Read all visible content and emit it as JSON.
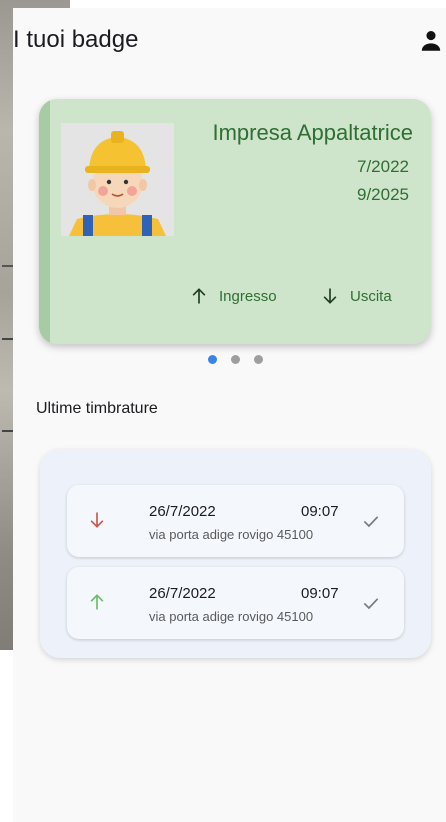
{
  "header": {
    "title": "I tuoi badge",
    "account_icon": "person-icon"
  },
  "badge": {
    "company": "Impresa Appaltatrice",
    "date_start": "7/2022",
    "date_end": "9/2025",
    "entry_label": "Ingresso",
    "exit_label": "Uscita",
    "color": "#cfe5cb",
    "accent": "#2e6f33"
  },
  "pager": {
    "count": 3,
    "active_index": 0
  },
  "recent": {
    "title": "Ultime timbrature",
    "items": [
      {
        "direction": "out",
        "date": "26/7/2022",
        "time": "09:07",
        "address": "via porta adige rovigo 45100",
        "status_icon": "check-icon",
        "color": "#c9574b"
      },
      {
        "direction": "in",
        "date": "26/7/2022",
        "time": "09:07",
        "address": "via porta adige rovigo 45100",
        "status_icon": "check-icon",
        "color": "#6bbd6b"
      }
    ]
  }
}
